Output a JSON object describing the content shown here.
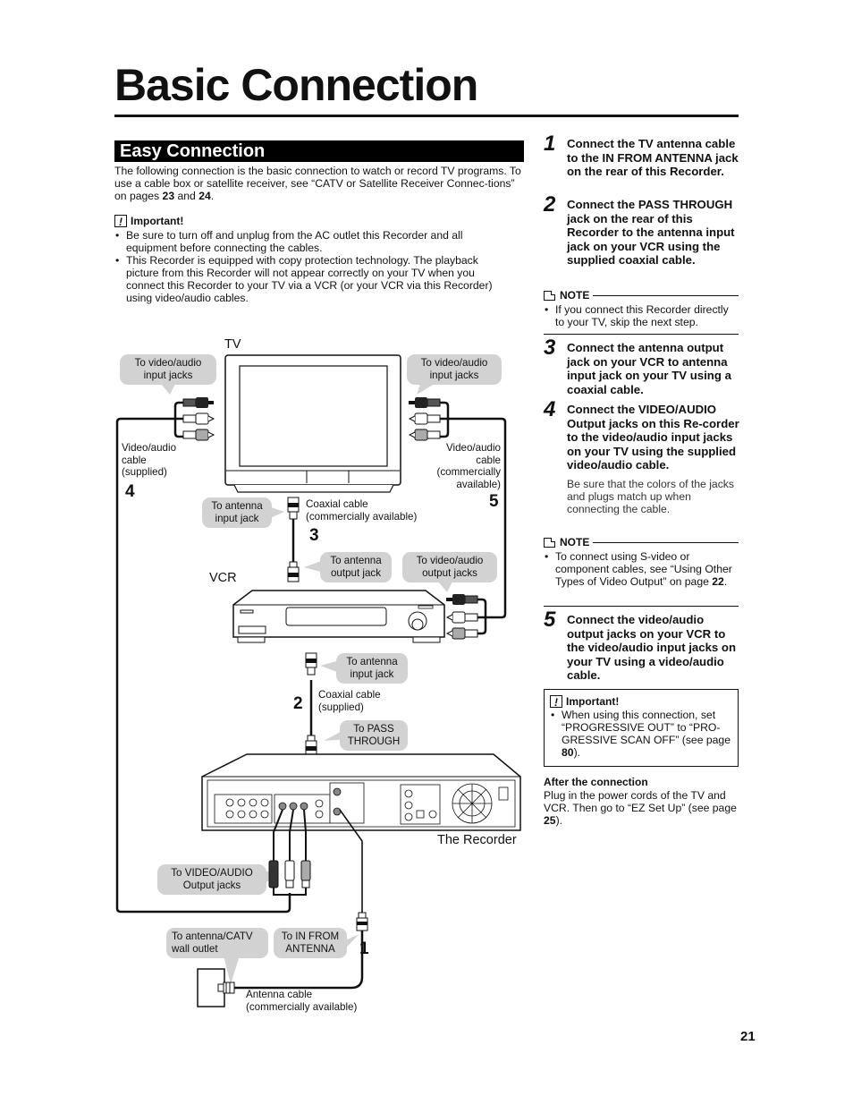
{
  "page": {
    "title": "Basic Connection",
    "section_title": "Easy Connection",
    "page_number": "21"
  },
  "intro": {
    "text_1": "The following connection is the basic connection to watch or record TV programs. To use a cable box or satellite receiver, see “CATV or Satellite Receiver Connec-tions” on pages ",
    "page_a": "23",
    "and": " and ",
    "page_b": "24",
    "end": "."
  },
  "important_top": {
    "icon": "exclamation-icon",
    "heading": "Important!",
    "bullets": [
      "Be sure to turn off and unplug from the AC outlet this Recorder and all equipment before connecting the cables.",
      "This Recorder is equipped with copy protection technology. The playback picture from this Recorder will not appear correctly on your TV when you connect this Recorder to your TV via a VCR (or your VCR via this Recorder) using video/audio cables."
    ]
  },
  "steps": [
    {
      "number": "1",
      "text": "Connect the TV antenna cable to the IN FROM ANTENNA jack on the rear of this Recorder."
    },
    {
      "number": "2",
      "text": "Connect the PASS THROUGH jack on the rear of this Recorder to the antenna input jack on your VCR using the supplied coaxial cable."
    },
    {
      "number": "3",
      "text": "Connect the antenna output jack on your VCR to antenna input jack on your TV using a coaxial cable."
    },
    {
      "number": "4",
      "text": "Connect the VIDEO/AUDIO Output jacks on this Re-corder to the video/audio input jacks on your TV using the supplied video/audio cable.",
      "sub": "Be sure that the colors of the jacks and plugs match up when connecting the cable."
    },
    {
      "number": "5",
      "text": "Connect the video/audio output jacks on your VCR to the video/audio input jacks on your TV using a video/audio cable."
    }
  ],
  "notes": [
    {
      "icon": "note-icon",
      "heading": "NOTE",
      "text": "If you connect this Recorder directly to your TV, skip the next step."
    },
    {
      "icon": "note-icon",
      "heading": "NOTE",
      "text_1": "To connect using S-video or component cables, see “Using Other Types of Video Output” on page ",
      "page": "22",
      "end": "."
    }
  ],
  "important_bottom": {
    "icon": "exclamation-icon",
    "heading": "Important!",
    "text_1": "When using this connection, set “PROGRESSIVE OUT” to “PRO-GRESSIVE SCAN OFF” (see page ",
    "page": "80",
    "end": ")."
  },
  "after": {
    "heading": "After the connection",
    "text_1": "Plug in the power cords of the TV and VCR. Then go to “EZ Set Up” (see page ",
    "page": "25",
    "end": ")."
  },
  "diagram": {
    "devices": {
      "tv": "TV",
      "vcr": "VCR",
      "recorder": "The Recorder"
    },
    "bubbles": {
      "tv_av_in_left": "To video/audio input jacks",
      "tv_av_in_right": "To video/audio input jacks",
      "tv_antenna_in": "To antenna input jack",
      "vcr_antenna_out": "To antenna output jack",
      "vcr_av_out": "To video/audio output jacks",
      "vcr_antenna_in": "To antenna input jack",
      "rec_pass_through": "To PASS THROUGH",
      "rec_av_out": "To VIDEO/AUDIO Output jacks",
      "wall_outlet": "To antenna/CATV wall outlet",
      "rec_in_antenna": "To IN FROM ANTENNA"
    },
    "labels": {
      "av_cable_supplied": "Video/audio cable (supplied)",
      "av_cable_commercial": "Video/audio cable (commercially available)",
      "coax_commercial": "Coaxial cable (commercially available)",
      "coax_supplied": "Coaxial cable (supplied)",
      "antenna_cable": "Antenna cable (commercially available)"
    },
    "step_markers": [
      "1",
      "2",
      "3",
      "4",
      "5"
    ]
  }
}
